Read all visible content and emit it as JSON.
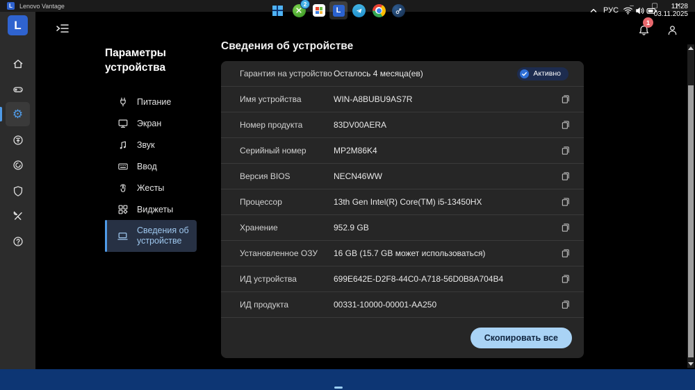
{
  "window": {
    "title": "Lenovo Vantage",
    "logo": "L",
    "controls": {
      "minimize": "–",
      "maximize": "▢",
      "close": "✕"
    }
  },
  "header": {
    "notification_count": "1"
  },
  "rail": {
    "logo": "L",
    "items": [
      {
        "name": "home",
        "icon": "home-icon"
      },
      {
        "name": "games",
        "icon": "gamepad-icon"
      },
      {
        "name": "device-settings",
        "icon": "gear-icon",
        "active": true,
        "glyph": "⚙"
      },
      {
        "name": "system-update",
        "icon": "update-icon"
      },
      {
        "name": "smart-features",
        "icon": "spiral-icon"
      },
      {
        "name": "security",
        "icon": "shield-icon"
      },
      {
        "name": "toolkit",
        "icon": "tools-icon"
      },
      {
        "name": "help",
        "icon": "help-icon"
      }
    ]
  },
  "nav": {
    "title": "Параметры устройства",
    "items": [
      {
        "label": "Питание",
        "icon": "power-plug-icon"
      },
      {
        "label": "Экран",
        "icon": "display-icon"
      },
      {
        "label": "Звук",
        "icon": "sound-note-icon"
      },
      {
        "label": "Ввод",
        "icon": "keyboard-icon"
      },
      {
        "label": "Жесты",
        "icon": "gesture-icon"
      },
      {
        "label": "Виджеты",
        "icon": "widgets-icon"
      },
      {
        "label": "Сведения об устройстве",
        "icon": "laptop-icon",
        "active": true
      }
    ]
  },
  "main": {
    "heading": "Сведения об устройстве",
    "warranty_badge": "Активно",
    "rows": [
      {
        "label": "Гарантия на устройство",
        "value": "Осталось 4 месяца(ев)"
      },
      {
        "label": "Имя устройства",
        "value": "WIN-A8BUBU9AS7R"
      },
      {
        "label": "Номер продукта",
        "value": "83DV00AERA"
      },
      {
        "label": "Серийный номер",
        "value": "MP2M86K4"
      },
      {
        "label": "Версия BIOS",
        "value": "NECN46WW"
      },
      {
        "label": "Процессор",
        "value": "13th Gen Intel(R) Core(TM) i5-13450HX"
      },
      {
        "label": "Хранение",
        "value": "952.9 GB"
      },
      {
        "label": "Установленное ОЗУ",
        "value": "16 GB (15.7 GB может использоваться)"
      },
      {
        "label": "ИД устройства",
        "value": "699E642E-D2F8-44C0-A718-56D0B8A704B4"
      },
      {
        "label": "ИД продукта",
        "value": "00331-10000-00001-AA250"
      }
    ],
    "copy_all_label": "Скопировать все"
  },
  "taskbar": {
    "apps": [
      {
        "name": "start",
        "icon": "windows-icon"
      },
      {
        "name": "xbox",
        "icon": "xbox-icon",
        "badge": "2"
      },
      {
        "name": "microsoft-store",
        "icon": "store-icon"
      },
      {
        "name": "lenovo-vantage",
        "icon": "vantage-icon",
        "label": "L",
        "active": true
      },
      {
        "name": "telegram",
        "icon": "telegram-icon"
      },
      {
        "name": "chrome",
        "icon": "chrome-icon"
      },
      {
        "name": "steam",
        "icon": "steam-icon"
      }
    ],
    "tray": {
      "language": "РУС",
      "time": "11:28",
      "date": "03.11.2025"
    }
  },
  "colors": {
    "accent": "#4f9be8",
    "badge_bg": "#1d2c4f",
    "button_bg": "#a9d3f5",
    "card_bg": "#262626",
    "taskbar_bg": "#0d3674",
    "rail_bg": "#2c2c2c"
  }
}
